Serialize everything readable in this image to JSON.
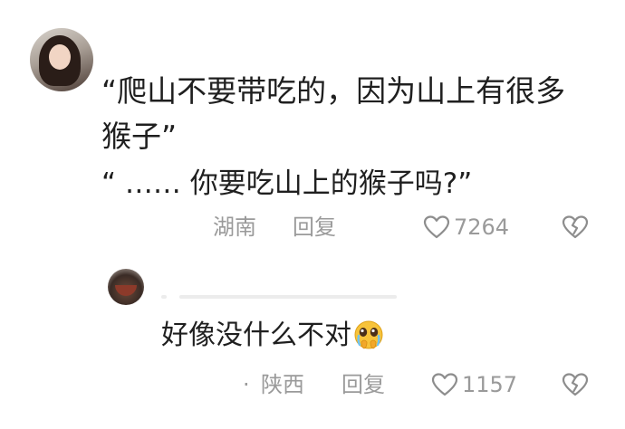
{
  "comment": {
    "lines": [
      "“爬山不要带吃的，因为山上有很多",
      "猴子”",
      "“ ……  你要吃山上的猴子吗?”"
    ],
    "location": "湖南",
    "reply_label": "回复",
    "like_count": "7264"
  },
  "reply": {
    "text": "好像没什么不对",
    "emoji": "pleading-face-with-hands-emoji",
    "separator": "·",
    "location": "陕西",
    "reply_label": "回复",
    "like_count": "1157"
  },
  "icons": {
    "like": "heart-outline-icon",
    "dislike": "broken-heart-icon"
  },
  "colors": {
    "text": "#1f1f1f",
    "meta": "#9a9a9a",
    "background": "#ffffff"
  }
}
